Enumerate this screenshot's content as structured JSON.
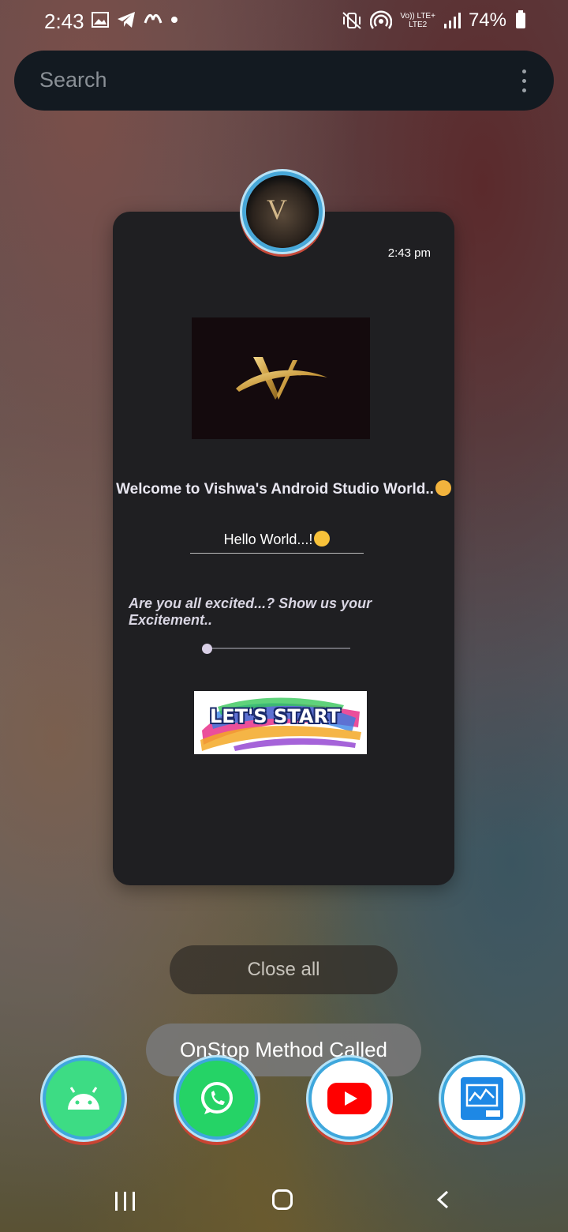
{
  "status_bar": {
    "time": "2:43",
    "notification_icons": [
      "gallery-icon",
      "telegram-icon",
      "app-icon",
      "dot"
    ],
    "right_icons": [
      "mute-vibrate-icon",
      "hotspot-icon",
      "volte-lte-icon",
      "signal-icon"
    ],
    "network_label_top": "Vo)) LTE+",
    "network_label_bottom": "LTE2",
    "battery": "74%"
  },
  "search": {
    "placeholder": "Search",
    "menu_icon": "more-vert-icon"
  },
  "recent_app": {
    "icon": "app-logo-icon",
    "time": "2:43 pm",
    "logo_letter": "V",
    "welcome_text": "Welcome to Vishwa's Android Studio World..",
    "hello_text": "Hello World...!",
    "excited_text": "Are you all excited...? Show us your Excitement..",
    "slider_value": 0,
    "lets_start_text": "LET'S START"
  },
  "close_all_label": "Close all",
  "toast_text": "OnStop Method Called",
  "dock": [
    {
      "name": "android-studio-icon",
      "color": "#3ddc84"
    },
    {
      "name": "whatsapp-icon",
      "color": "#25d366"
    },
    {
      "name": "youtube-icon",
      "color": "#ff0000"
    },
    {
      "name": "analytics-lite-icon",
      "color": "#1e88e5"
    }
  ],
  "nav": {
    "recents": "recents-icon",
    "home": "home-icon",
    "back": "back-icon"
  }
}
